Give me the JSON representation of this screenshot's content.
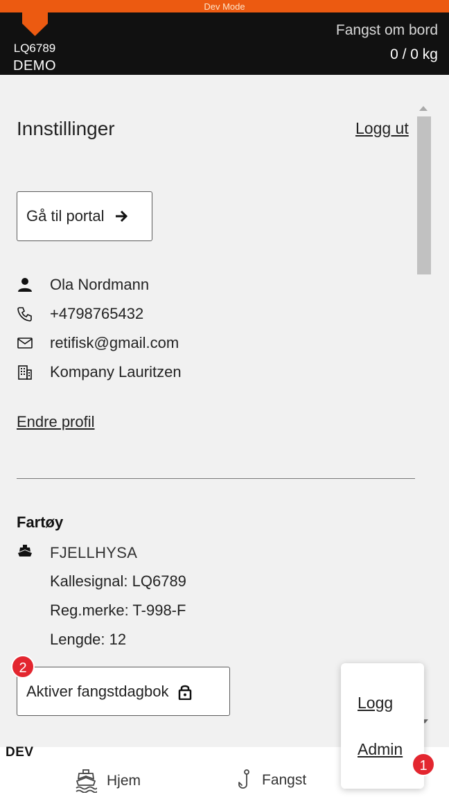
{
  "dev_mode_label": "Dev Mode",
  "header": {
    "callsign": "LQ6789",
    "demo_label": "DEMO",
    "catch_label": "Fangst om bord",
    "catch_value": "0 / 0 kg"
  },
  "settings": {
    "title": "Innstillinger",
    "logout_label": "Logg ut",
    "portal_button_label": "Gå til portal",
    "profile": {
      "name": "Ola Nordmann",
      "phone": "+4798765432",
      "email": "retifisk@gmail.com",
      "company": "Kompany Lauritzen"
    },
    "edit_profile_label": "Endre profil"
  },
  "vessel": {
    "heading": "Fartøy",
    "name": "FJELLHYSA",
    "callsign_line": "Kallesignal: LQ6789",
    "reg_line": "Reg.merke: T-998-F",
    "length_line": "Lengde: 12",
    "activate_label": "Aktiver fangstdagbok"
  },
  "badges": {
    "activate": "2",
    "admin": "1"
  },
  "bottom_nav": {
    "dev_label": "DEV",
    "home_label": "Hjem",
    "catch_label": "Fangst"
  },
  "popup_menu": {
    "items": [
      "Logg",
      "Admin"
    ]
  },
  "colors": {
    "dev_bar": "#ec5a11",
    "header_bg": "#111111",
    "badge": "#e3262f",
    "page_bg": "#f1f1f1"
  },
  "icons": {
    "header_flag": "orange-pennant-icon",
    "portal": "arrow-right-icon",
    "name": "person-icon",
    "phone": "phone-icon",
    "email": "mail-icon",
    "company": "building-icon",
    "vessel": "ship-icon",
    "activate": "lock-icon",
    "home": "boat-waves-icon",
    "catch": "fish-hook-icon"
  }
}
